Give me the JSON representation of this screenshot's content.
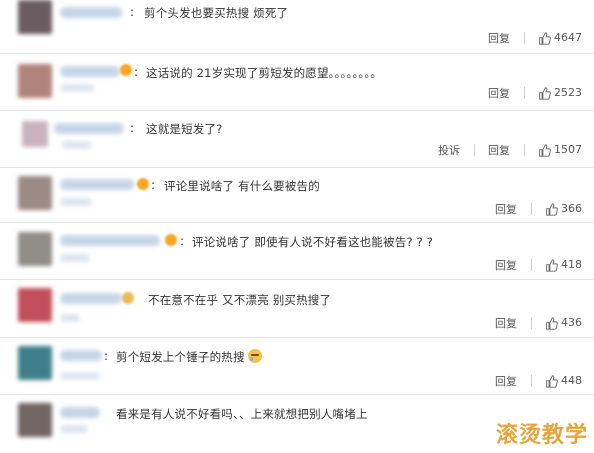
{
  "actions": {
    "report_label": "投诉",
    "reply_label": "回复"
  },
  "comments": [
    {
      "colon": ":",
      "text": "剪个头发也要买热搜 烦死了",
      "likes": "4647",
      "has_report": false,
      "has_emoji": false
    },
    {
      "colon": ":",
      "text": "这话说的 21岁实现了剪短发的愿望。。。。。。。。",
      "likes": "2523",
      "has_report": false,
      "has_emoji": false
    },
    {
      "colon": ":",
      "text": "这就是短发了?",
      "likes": "1507",
      "has_report": true,
      "has_emoji": false
    },
    {
      "colon": ":",
      "text": "评论里说啥了 有什么要被告的",
      "likes": "366",
      "has_report": false,
      "has_emoji": false
    },
    {
      "colon": ":",
      "text": "评论说啥了 即使有人说不好看这也能被告? ? ?",
      "likes": "418",
      "has_report": false,
      "has_emoji": false
    },
    {
      "colon": ":",
      "text": "不在意不在乎 又不漂亮 别买热搜了",
      "likes": "436",
      "has_report": false,
      "has_emoji": false
    },
    {
      "colon": ":",
      "text": "剪个短发上个锤子的热搜",
      "likes": "448",
      "has_report": false,
      "has_emoji": true
    },
    {
      "colon": ":",
      "text": "看来是有人说不好看吗、、上来就想把别人嘴堵上",
      "likes": "",
      "has_report": false,
      "has_emoji": false
    }
  ],
  "watermark": "滚烫教学",
  "colors": {
    "accent": "#e8a43c",
    "divider": "#e6e6e6"
  }
}
